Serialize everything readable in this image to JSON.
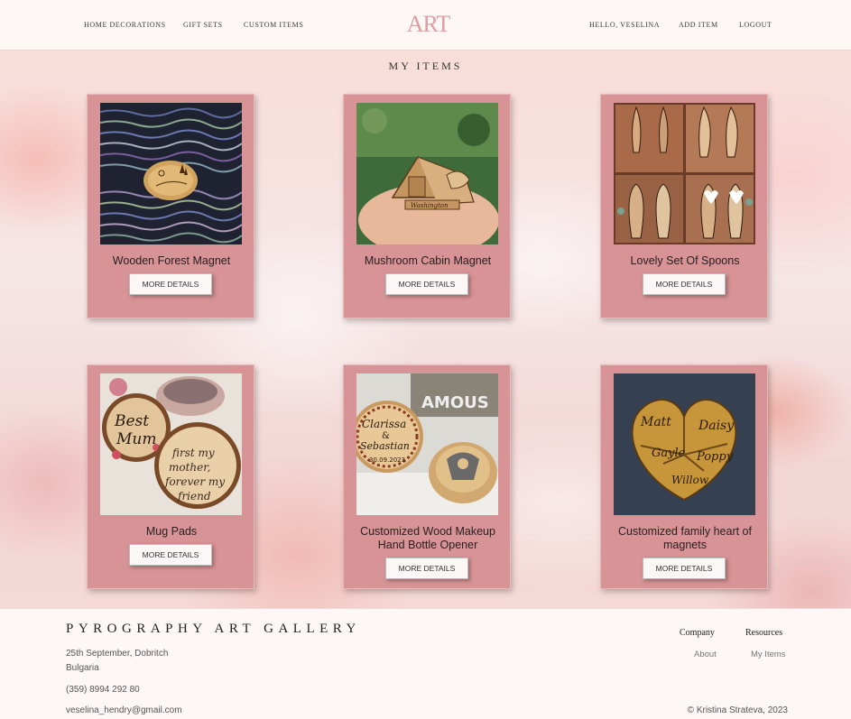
{
  "nav": {
    "left": [
      "HOME DECORATIONS",
      "GIFT SETS",
      "CUSTOM ITEMS"
    ],
    "right": [
      "HELLO, VESELINA",
      "ADD ITEM",
      "LOGOUT"
    ],
    "logo_text": "ART"
  },
  "page_title": "MY ITEMS",
  "items": [
    {
      "name": "Wooden Forest Magnet",
      "button": "MORE DETAILS",
      "icon": "forest-magnet-image"
    },
    {
      "name": "Mushroom Cabin Magnet",
      "button": "MORE DETAILS",
      "icon": "cabin-magnet-image"
    },
    {
      "name": "Lovely Set Of Spoons",
      "button": "MORE DETAILS",
      "icon": "spoons-image"
    },
    {
      "name": "Mug Pads",
      "button": "MORE DETAILS",
      "icon": "mug-pads-image"
    },
    {
      "name": "Customized Wood Makeup Hand Bottle Opener",
      "button": "MORE DETAILS",
      "icon": "bottle-opener-image"
    },
    {
      "name": "Customized family heart of magnets",
      "button": "MORE DETAILS",
      "icon": "heart-magnets-image"
    }
  ],
  "footer": {
    "brand": "PYROGRAPHY ART GALLERY",
    "address_line1": "25th September, Dobritch",
    "address_line2": "Bulgaria",
    "phone": "(359) 8994 292 80",
    "email": "veselina_hendry@gmail.com",
    "company_heading": "Company",
    "company_link": "About",
    "resources_heading": "Resources",
    "resources_link": "My Items",
    "copyright": "© Kristina Strateva, 2023"
  },
  "colors": {
    "card": "#d79395",
    "header_bg": "#fdf8f6",
    "logo": "#d88e94"
  }
}
